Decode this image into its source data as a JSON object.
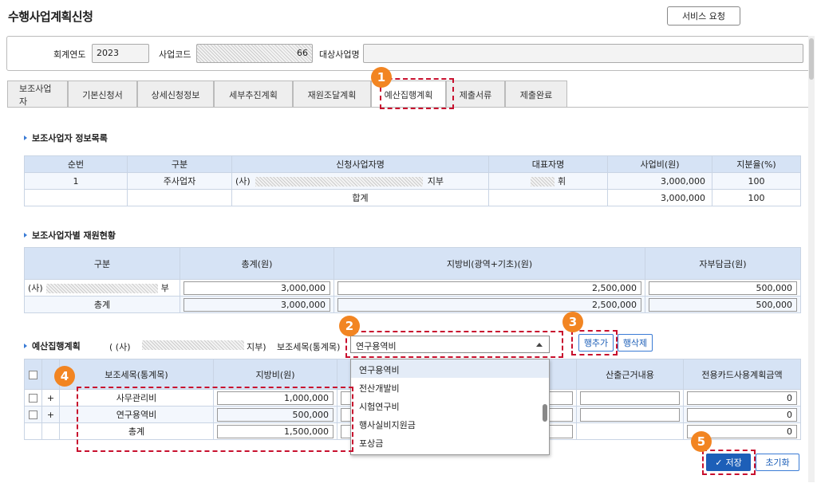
{
  "page_title": "수행사업계획신청",
  "service_request_label": "서비스 요청",
  "filters": {
    "year_label": "회계연도",
    "year_value": "2023",
    "code_label": "사업코드",
    "code_value_suffix": "66",
    "target_label": "대상사업명"
  },
  "tabs": [
    {
      "label": "보조사업자"
    },
    {
      "label": "기본신청서"
    },
    {
      "label": "상세신청정보"
    },
    {
      "label": "세부추진계획"
    },
    {
      "label": "재원조달계획"
    },
    {
      "label": "예산집행계획",
      "active": true
    },
    {
      "label": "제출서류"
    },
    {
      "label": "제출완료"
    }
  ],
  "section1": {
    "title": "보조사업자 정보목록",
    "headers": [
      "순번",
      "구분",
      "신청사업자명",
      "대표자명",
      "사업비(원)",
      "지분율(%)"
    ],
    "row": {
      "no": "1",
      "type": "주사업자",
      "name_prefix": "(사)",
      "name_suffix": "지부",
      "rep_suffix": "휘",
      "cost": "3,000,000",
      "share": "100"
    },
    "total": {
      "label": "합계",
      "cost": "3,000,000",
      "share": "100"
    }
  },
  "section2": {
    "title": "보조사업자별 재원현황",
    "headers": [
      "구분",
      "총계(원)",
      "지방비(광역+기초)(원)",
      "자부담금(원)"
    ],
    "row": {
      "name_prefix": "(사)",
      "name_suffix": "부",
      "total": "3,000,000",
      "local": "2,500,000",
      "self": "500,000"
    },
    "sum": {
      "label": "총계",
      "total": "3,000,000",
      "local": "2,500,000",
      "self": "500,000"
    }
  },
  "section3": {
    "title": "예산집행계획",
    "org_prefix": "( (사)",
    "org_suffix": "지부)",
    "category_label": "보조세목(통계목)",
    "selected": "연구용역비",
    "options": [
      "연구용역비",
      "전산개발비",
      "시험연구비",
      "행사실비지원금",
      "포상금"
    ],
    "add_row_label": "행추가",
    "del_row_label": "행삭제",
    "headers": [
      "보조세목(통계목)",
      "지방비(원)",
      "산출근거내용",
      "전용카드사용계획금액"
    ],
    "rows": [
      {
        "plus": "+",
        "name": "사무관리비",
        "local": "1,000,000",
        "card": "0"
      },
      {
        "plus": "+",
        "name": "연구용역비",
        "local": "500,000",
        "card": "0"
      }
    ],
    "sum": {
      "label": "총계",
      "local": "1,500,000",
      "card": "0"
    }
  },
  "save_label": "저장",
  "reset_label": "초기화",
  "step_badges": [
    "1",
    "2",
    "3",
    "4",
    "5"
  ],
  "colors": {
    "highlight": "#c8102e",
    "badge": "#f28522",
    "header_bg": "#d6e3f5",
    "primary": "#1d5fb8"
  }
}
